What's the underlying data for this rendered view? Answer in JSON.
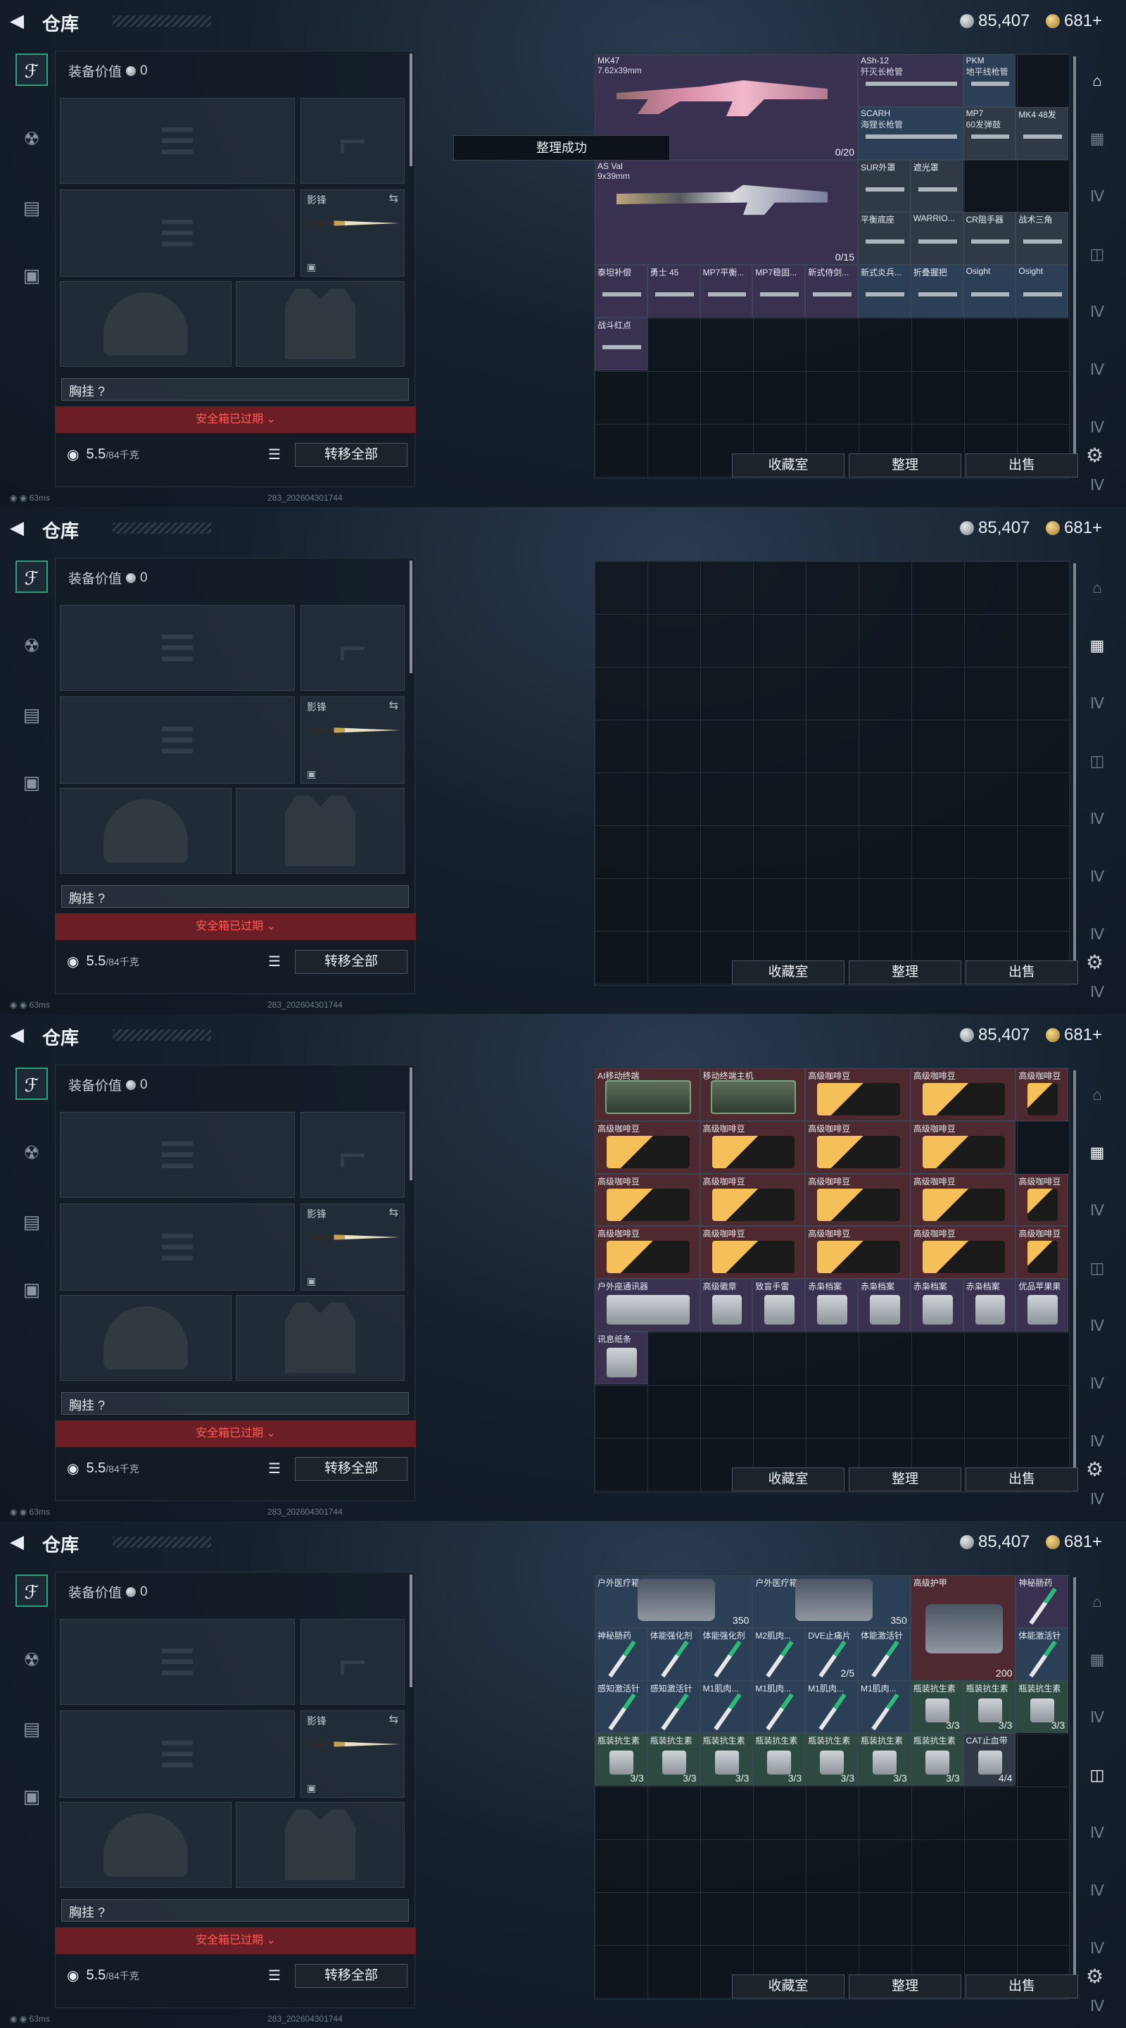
{
  "panels": [
    {
      "id": "p1",
      "header": {
        "title": "仓库",
        "silver": "85,407",
        "gold": "681+"
      },
      "equip_value_label": "装备价值",
      "equip_value": "0",
      "melee_label": "影锋",
      "chest_label": "胸挂 ?",
      "safe_box": "安全箱已过期 ",
      "weight_value": "5.5",
      "weight_unit": "/84千克",
      "transfer_all": "转移全部",
      "btn_collection": "收藏室",
      "btn_sort": "整理",
      "btn_sell": "出售",
      "toast": "整理成功",
      "footer_ping": "63ms",
      "footer_build": "283_202604301744"
    },
    {
      "id": "p2",
      "header": {
        "title": "仓库",
        "silver": "85,407",
        "gold": "681+"
      },
      "equip_value_label": "装备价值",
      "equip_value": "0",
      "melee_label": "影锋",
      "chest_label": "胸挂 ?",
      "safe_box": "安全箱已过期 ",
      "weight_value": "5.5",
      "weight_unit": "/84千克",
      "transfer_all": "转移全部",
      "btn_collection": "收藏室",
      "btn_sort": "整理",
      "btn_sell": "出售",
      "footer_ping": "63ms",
      "footer_build": "283_202604301744"
    },
    {
      "id": "p3",
      "header": {
        "title": "仓库",
        "silver": "85,407",
        "gold": "681+"
      },
      "equip_value_label": "装备价值",
      "equip_value": "0",
      "melee_label": "影锋",
      "chest_label": "胸挂 ?",
      "safe_box": "安全箱已过期 ",
      "weight_value": "5.5",
      "weight_unit": "/84千克",
      "transfer_all": "转移全部",
      "btn_collection": "收藏室",
      "btn_sort": "整理",
      "btn_sell": "出售",
      "footer_ping": "63ms",
      "footer_build": "283_202604301744"
    },
    {
      "id": "p4",
      "header": {
        "title": "仓库",
        "silver": "85,407",
        "gold": "681+"
      },
      "equip_value_label": "装备价值",
      "equip_value": "0",
      "melee_label": "影锋",
      "chest_label": "胸挂 ?",
      "safe_box": "安全箱已过期 ",
      "weight_value": "5.5",
      "weight_unit": "/84千克",
      "transfer_all": "转移全部",
      "btn_collection": "收藏室",
      "btn_sort": "整理",
      "btn_sell": "出售",
      "footer_ping": "63ms",
      "footer_build": "283_202604301744"
    }
  ],
  "p1_items": [
    {
      "name": "MK47",
      "sub": "7.62x39mm",
      "qty": "0/20",
      "icon": "rifle-icon",
      "color": "purple"
    },
    {
      "name": "AS Val",
      "sub": "9x39mm",
      "qty": "0/15",
      "icon": "rifle-icon",
      "color": "purple"
    },
    {
      "name": "ASh-12",
      "sub": "歼灭长枪管",
      "qty": "",
      "icon": "barrel-icon",
      "color": "purple"
    },
    {
      "name": "PKM",
      "sub": "地平线枪管",
      "qty": "",
      "icon": "barrel-icon",
      "color": "blue"
    },
    {
      "name": "SCARH",
      "sub": "海狸长枪管",
      "qty": "",
      "icon": "barrel-icon",
      "color": "blue"
    },
    {
      "name": "MP7",
      "sub": "60发弹鼓",
      "qty": "",
      "icon": "drum-mag-icon",
      "color": "grey"
    },
    {
      "name": "MK4 48发",
      "sub": "",
      "qty": "",
      "icon": "magazine-icon",
      "color": "grey"
    },
    {
      "name": "SUR外罩",
      "sub": "",
      "qty": "",
      "icon": "handguard-icon",
      "color": "grey"
    },
    {
      "name": "遮光罩",
      "sub": "",
      "qty": "",
      "icon": "scope-cap-icon",
      "color": "grey"
    },
    {
      "name": "平衡底座",
      "sub": "",
      "qty": "",
      "icon": "mount-icon",
      "color": "grey"
    },
    {
      "name": "WARRIO...",
      "sub": "",
      "qty": "",
      "icon": "grip-icon",
      "color": "grey"
    },
    {
      "name": "CR阻手器",
      "sub": "",
      "qty": "",
      "icon": "grip-icon",
      "color": "grey"
    },
    {
      "name": "战术三角",
      "sub": "",
      "qty": "",
      "icon": "grip-icon",
      "color": "grey"
    },
    {
      "name": "泰坦补偿",
      "sub": "",
      "qty": "",
      "icon": "muzzle-icon",
      "color": "purple"
    },
    {
      "name": "勇士 45",
      "sub": "",
      "qty": "",
      "icon": "magazine-icon",
      "color": "purple"
    },
    {
      "name": "MP7平衡...",
      "sub": "",
      "qty": "",
      "icon": "stock-icon",
      "color": "purple"
    },
    {
      "name": "MP7稳固...",
      "sub": "",
      "qty": "",
      "icon": "stock-icon",
      "color": "purple"
    },
    {
      "name": "新式侍剑...",
      "sub": "",
      "qty": "",
      "icon": "grip-icon",
      "color": "purple"
    },
    {
      "name": "新式炎兵...",
      "sub": "",
      "qty": "",
      "icon": "grip-icon",
      "color": "blue"
    },
    {
      "name": "折叠握把",
      "sub": "",
      "qty": "",
      "icon": "grip-icon",
      "color": "blue"
    },
    {
      "name": "Osight",
      "sub": "",
      "qty": "",
      "icon": "sight-icon",
      "color": "blue"
    },
    {
      "name": "Osight",
      "sub": "",
      "qty": "",
      "icon": "sight-icon",
      "color": "blue"
    },
    {
      "name": "战斗红点",
      "sub": "",
      "qty": "",
      "icon": "red-dot-icon",
      "color": "purple"
    }
  ],
  "p3_items": [
    {
      "name": "AI移动终端",
      "qty": "",
      "color": "red"
    },
    {
      "name": "移动终端主机",
      "qty": "",
      "color": "red"
    },
    {
      "name": "高级咖啡豆",
      "qty": "",
      "color": "red"
    },
    {
      "name": "高级咖啡豆",
      "qty": "",
      "color": "red"
    },
    {
      "name": "高级咖啡豆",
      "qty": "",
      "color": "red"
    },
    {
      "name": "高级咖啡豆",
      "qty": "",
      "color": "red"
    },
    {
      "name": "高级咖啡豆",
      "qty": "",
      "color": "red"
    },
    {
      "name": "高级咖啡豆",
      "qty": "",
      "color": "red"
    },
    {
      "name": "高级咖啡豆",
      "qty": "",
      "color": "red"
    },
    {
      "name": "高级咖啡豆",
      "qty": "",
      "color": "red"
    },
    {
      "name": "高级咖啡豆",
      "qty": "",
      "color": "red"
    },
    {
      "name": "高级咖啡豆",
      "qty": "",
      "color": "red"
    },
    {
      "name": "高级咖啡豆",
      "qty": "",
      "color": "red"
    },
    {
      "name": "高级咖啡豆",
      "qty": "",
      "color": "red"
    },
    {
      "name": "高级咖啡豆",
      "qty": "",
      "color": "red"
    },
    {
      "name": "高级咖啡豆",
      "qty": "",
      "color": "red"
    },
    {
      "name": "高级咖啡豆",
      "qty": "",
      "color": "red"
    },
    {
      "name": "高级咖啡豆",
      "qty": "",
      "color": "red"
    },
    {
      "name": "高级咖啡豆",
      "qty": "",
      "color": "red"
    },
    {
      "name": "户外座通讯器",
      "qty": "",
      "color": "purple"
    },
    {
      "name": "高级徽章",
      "qty": "",
      "color": "purple"
    },
    {
      "name": "致盲手雷",
      "qty": "",
      "color": "purple"
    },
    {
      "name": "赤枭档案",
      "qty": "",
      "color": "purple"
    },
    {
      "name": "赤枭档案",
      "qty": "",
      "color": "purple"
    },
    {
      "name": "赤枭档案",
      "qty": "",
      "color": "purple"
    },
    {
      "name": "赤枭档案",
      "qty": "",
      "color": "purple"
    },
    {
      "name": "优品苹果果",
      "qty": "",
      "color": "purple"
    },
    {
      "name": "讯息纸条",
      "qty": "",
      "color": "purple"
    }
  ],
  "p4_items": [
    {
      "name": "户外医疗箱",
      "qty": "350",
      "color": "blue"
    },
    {
      "name": "户外医疗箱",
      "qty": "350",
      "color": "blue"
    },
    {
      "name": "高级护甲",
      "qty": "200",
      "color": "red"
    },
    {
      "name": "神秘肠药",
      "qty": "",
      "color": "purple"
    },
    {
      "name": "神秘肠药",
      "qty": "",
      "color": "blue"
    },
    {
      "name": "体能强化剂",
      "qty": "",
      "color": "blue"
    },
    {
      "name": "体能强化剂",
      "qty": "",
      "color": "blue"
    },
    {
      "name": "M2肌肉...",
      "qty": "",
      "color": "blue"
    },
    {
      "name": "DVE止痛片",
      "qty": "2/5",
      "color": "blue"
    },
    {
      "name": "体能激活针",
      "qty": "",
      "color": "blue"
    },
    {
      "name": "体能激活针",
      "qty": "",
      "color": "blue"
    },
    {
      "name": "感知激活针",
      "qty": "",
      "color": "blue"
    },
    {
      "name": "感知激活针",
      "qty": "",
      "color": "blue"
    },
    {
      "name": "M1肌肉...",
      "qty": "",
      "color": "blue"
    },
    {
      "name": "M1肌肉...",
      "qty": "",
      "color": "blue"
    },
    {
      "name": "M1肌肉...",
      "qty": "",
      "color": "blue"
    },
    {
      "name": "M1肌肉...",
      "qty": "",
      "color": "blue"
    },
    {
      "name": "瓶装抗生素",
      "qty": "3/3",
      "color": "green"
    },
    {
      "name": "瓶装抗生素",
      "qty": "3/3",
      "color": "green"
    },
    {
      "name": "瓶装抗生素",
      "qty": "3/3",
      "color": "green"
    },
    {
      "name": "瓶装抗生素",
      "qty": "3/3",
      "color": "green"
    },
    {
      "name": "瓶装抗生素",
      "qty": "3/3",
      "color": "green"
    },
    {
      "name": "瓶装抗生素",
      "qty": "3/3",
      "color": "green"
    },
    {
      "name": "瓶装抗生素",
      "qty": "3/3",
      "color": "green"
    },
    {
      "name": "瓶装抗生素",
      "qty": "3/3",
      "color": "green"
    },
    {
      "name": "瓶装抗生素",
      "qty": "3/3",
      "color": "green"
    },
    {
      "name": "瓶装抗生素",
      "qty": "3/3",
      "color": "green"
    },
    {
      "name": "CAT止血带",
      "qty": "4/4",
      "color": "grey"
    }
  ],
  "colors": {
    "accent_green": "#2fa17a",
    "safe_red": "#6b1e23"
  }
}
